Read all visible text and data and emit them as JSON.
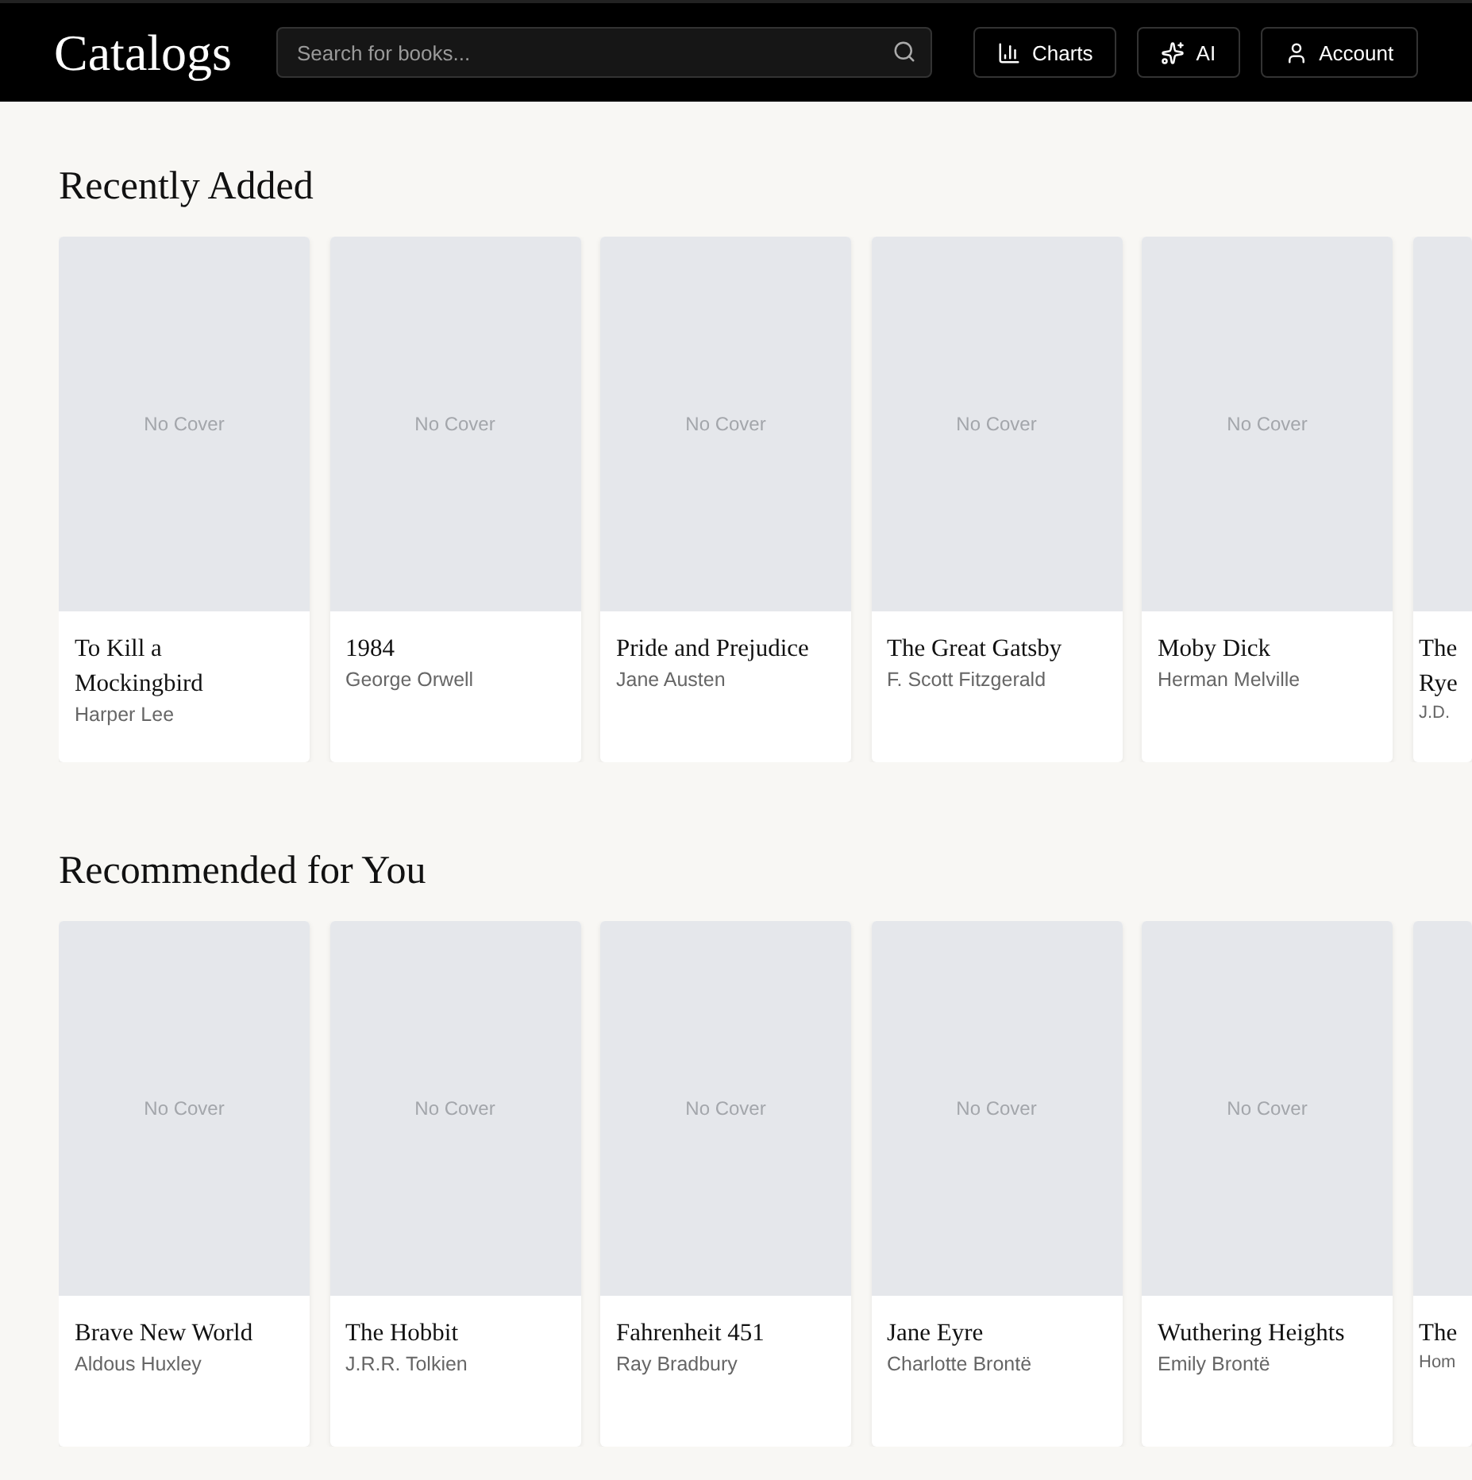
{
  "header": {
    "title": "Catalogs",
    "search": {
      "placeholder": "Search for books..."
    },
    "buttons": [
      {
        "label": "Charts",
        "kind": "charts"
      },
      {
        "label": "AI",
        "kind": "ai"
      },
      {
        "label": "Account",
        "kind": "account"
      }
    ]
  },
  "sections": [
    {
      "title": "Recently Added",
      "books": [
        {
          "kind": "full",
          "cover": "No Cover",
          "title": "To Kill a Mockingbird",
          "author": "Harper Lee"
        },
        {
          "kind": "full",
          "cover": "No Cover",
          "title": "1984",
          "author": "George Orwell"
        },
        {
          "kind": "full",
          "cover": "No Cover",
          "title": "Pride and Prejudice",
          "author": "Jane Austen"
        },
        {
          "kind": "full",
          "cover": "No Cover",
          "title": "The Great Gatsby",
          "author": "F. Scott Fitzgerald"
        },
        {
          "kind": "full",
          "cover": "No Cover",
          "title": "Moby Dick",
          "author": "Herman Melville"
        },
        {
          "kind": "cut",
          "title_lines": [
            "The",
            "Rye"
          ],
          "author": "J.D."
        }
      ]
    },
    {
      "title": "Recommended for You",
      "books": [
        {
          "kind": "full",
          "cover": "No Cover",
          "title": "Brave New World",
          "author": "Aldous Huxley"
        },
        {
          "kind": "full",
          "cover": "No Cover",
          "title": "The Hobbit",
          "author": "J.R.R. Tolkien"
        },
        {
          "kind": "full",
          "cover": "No Cover",
          "title": "Fahrenheit 451",
          "author": "Ray Bradbury"
        },
        {
          "kind": "full",
          "cover": "No Cover",
          "title": "Jane Eyre",
          "author": "Charlotte Brontë"
        },
        {
          "kind": "full",
          "cover": "No Cover",
          "title": "Wuthering Heights",
          "author": "Emily Brontë"
        },
        {
          "kind": "cut",
          "title_lines": [
            "The"
          ],
          "author": "Hom"
        }
      ]
    }
  ]
}
